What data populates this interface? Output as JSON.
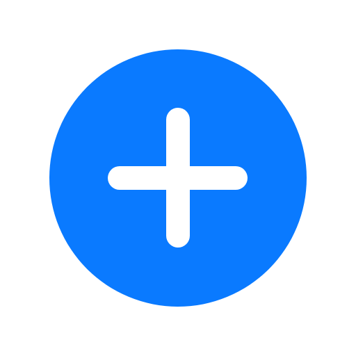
{
  "add_button": {
    "icon": "plus-icon",
    "background_color": "#0A7AFF",
    "icon_color": "#FFFFFF"
  },
  "page": {
    "background_color": "#FFFFFF"
  }
}
